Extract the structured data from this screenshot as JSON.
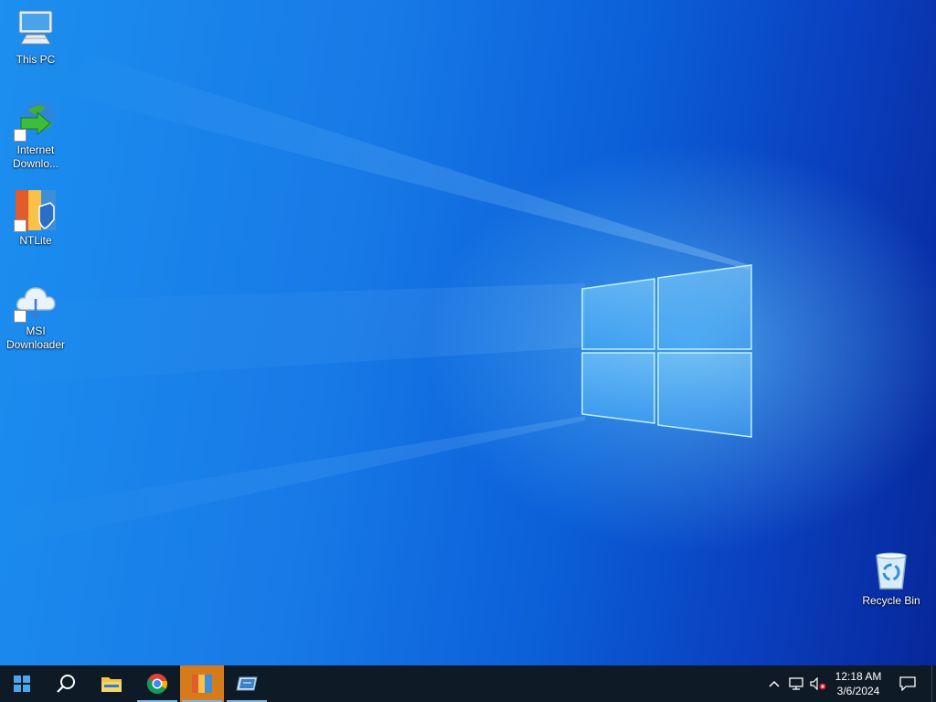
{
  "desktop_icons": [
    {
      "name": "this-pc",
      "label": "This PC"
    },
    {
      "name": "internet-download-manager",
      "label_line1": "Internet",
      "label_line2": "Downlo..."
    },
    {
      "name": "ntlite",
      "label": "NTLite"
    },
    {
      "name": "msi-downloader",
      "label_line1": "MSI",
      "label_line2": "Downloader"
    },
    {
      "name": "recycle-bin",
      "label": "Recycle Bin"
    }
  ],
  "taskbar": {
    "start_icon": "windows-logo-icon",
    "search_icon": "search-icon",
    "pinned": [
      {
        "name": "file-explorer",
        "icon": "folder-icon"
      },
      {
        "name": "chrome",
        "icon": "chrome-icon"
      },
      {
        "name": "ntlite",
        "icon": "ntlite-icon",
        "state": "highlighted"
      },
      {
        "name": "msi-downloader-window",
        "icon": "app-window-icon",
        "state": "running"
      }
    ],
    "tray": {
      "icons": [
        "chevron-up-icon",
        "network-icon",
        "volume-muted-icon"
      ],
      "time": "12:18 AM",
      "date": "3/6/2024",
      "notification_icon": "action-center-icon"
    }
  },
  "colors": {
    "taskbar_bg": "#0e1a26",
    "active_indicator": "#76b9ed",
    "highlight": "#d67b1b"
  }
}
